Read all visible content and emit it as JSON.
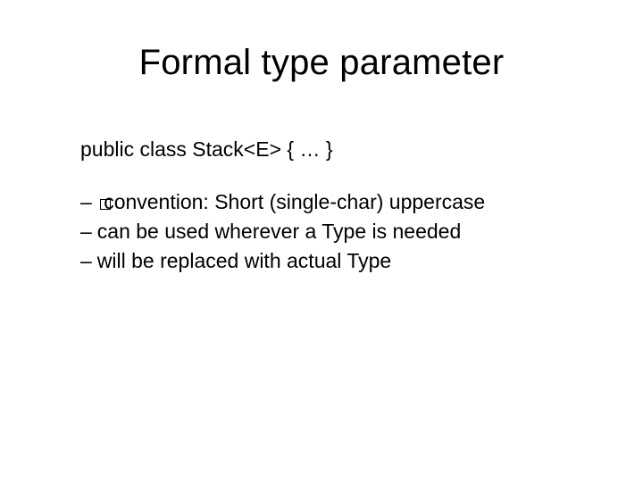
{
  "slide": {
    "title": "Formal type parameter",
    "code_line": "public class Stack<E> { … }",
    "bullets": [
      {
        "dash": "– ",
        "text": "convention: Short (single-char) uppercase",
        "has_box_overlay": true
      },
      {
        "dash": "– ",
        "text": "can be used wherever a Type is needed",
        "has_box_overlay": false
      },
      {
        "dash": "– ",
        "text": "will be replaced with actual Type",
        "has_box_overlay": false
      }
    ]
  }
}
